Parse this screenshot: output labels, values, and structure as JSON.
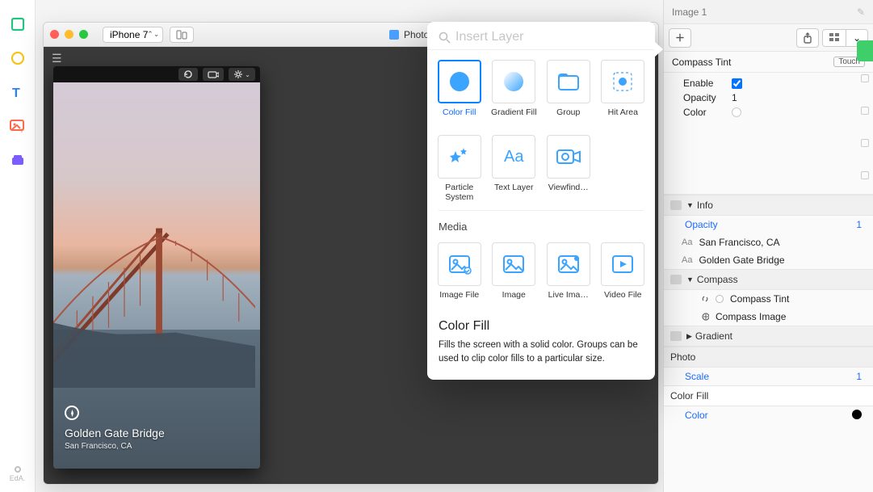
{
  "left_tools": [
    "rect-icon",
    "circle-icon",
    "text-icon",
    "image-icon",
    "group-icon"
  ],
  "left_bottom_label": "EdA.",
  "device_window": {
    "device_name": "iPhone 7",
    "title": "Photo Zoom"
  },
  "phone": {
    "title": "Golden Gate Bridge",
    "subtitle": "San Francisco, CA"
  },
  "popover": {
    "search_placeholder": "Insert Layer",
    "row1": [
      {
        "id": "color-fill",
        "label": "Color Fill",
        "selected": true
      },
      {
        "id": "gradient-fill",
        "label": "Gradient Fill"
      },
      {
        "id": "group",
        "label": "Group"
      },
      {
        "id": "hit-area",
        "label": "Hit Area"
      }
    ],
    "row2": [
      {
        "id": "particle-system",
        "label": "Particle System"
      },
      {
        "id": "text-layer",
        "label": "Text Layer"
      },
      {
        "id": "viewfinder",
        "label": "Viewfind…"
      }
    ],
    "media_heading": "Media",
    "row3": [
      {
        "id": "image-file",
        "label": "Image File"
      },
      {
        "id": "image",
        "label": "Image"
      },
      {
        "id": "live-image",
        "label": "Live Ima…"
      },
      {
        "id": "video-file",
        "label": "Video File"
      }
    ],
    "detail_title": "Color Fill",
    "detail_body": "Fills the screen with a solid color. Groups can be used to clip color fills to a particular size."
  },
  "right": {
    "header_title": "Image 1",
    "section_title": "Compass Tint",
    "section_badge": "Touch",
    "props": {
      "enable_label": "Enable",
      "enable": true,
      "opacity_label": "Opacity",
      "opacity": "1",
      "color_label": "Color"
    },
    "tree": {
      "info_label": "Info",
      "info_opacity_label": "Opacity",
      "info_opacity_val": "1",
      "text_city": "San Francisco, CA",
      "text_title": "Golden Gate Bridge",
      "compass_label": "Compass",
      "compass_tint": "Compass Tint",
      "compass_image": "Compass Image",
      "gradient_label": "Gradient",
      "photo_label": "Photo",
      "photo_scale_label": "Scale",
      "photo_scale_val": "1",
      "color_fill_label": "Color Fill",
      "color_fill_color_label": "Color"
    }
  }
}
